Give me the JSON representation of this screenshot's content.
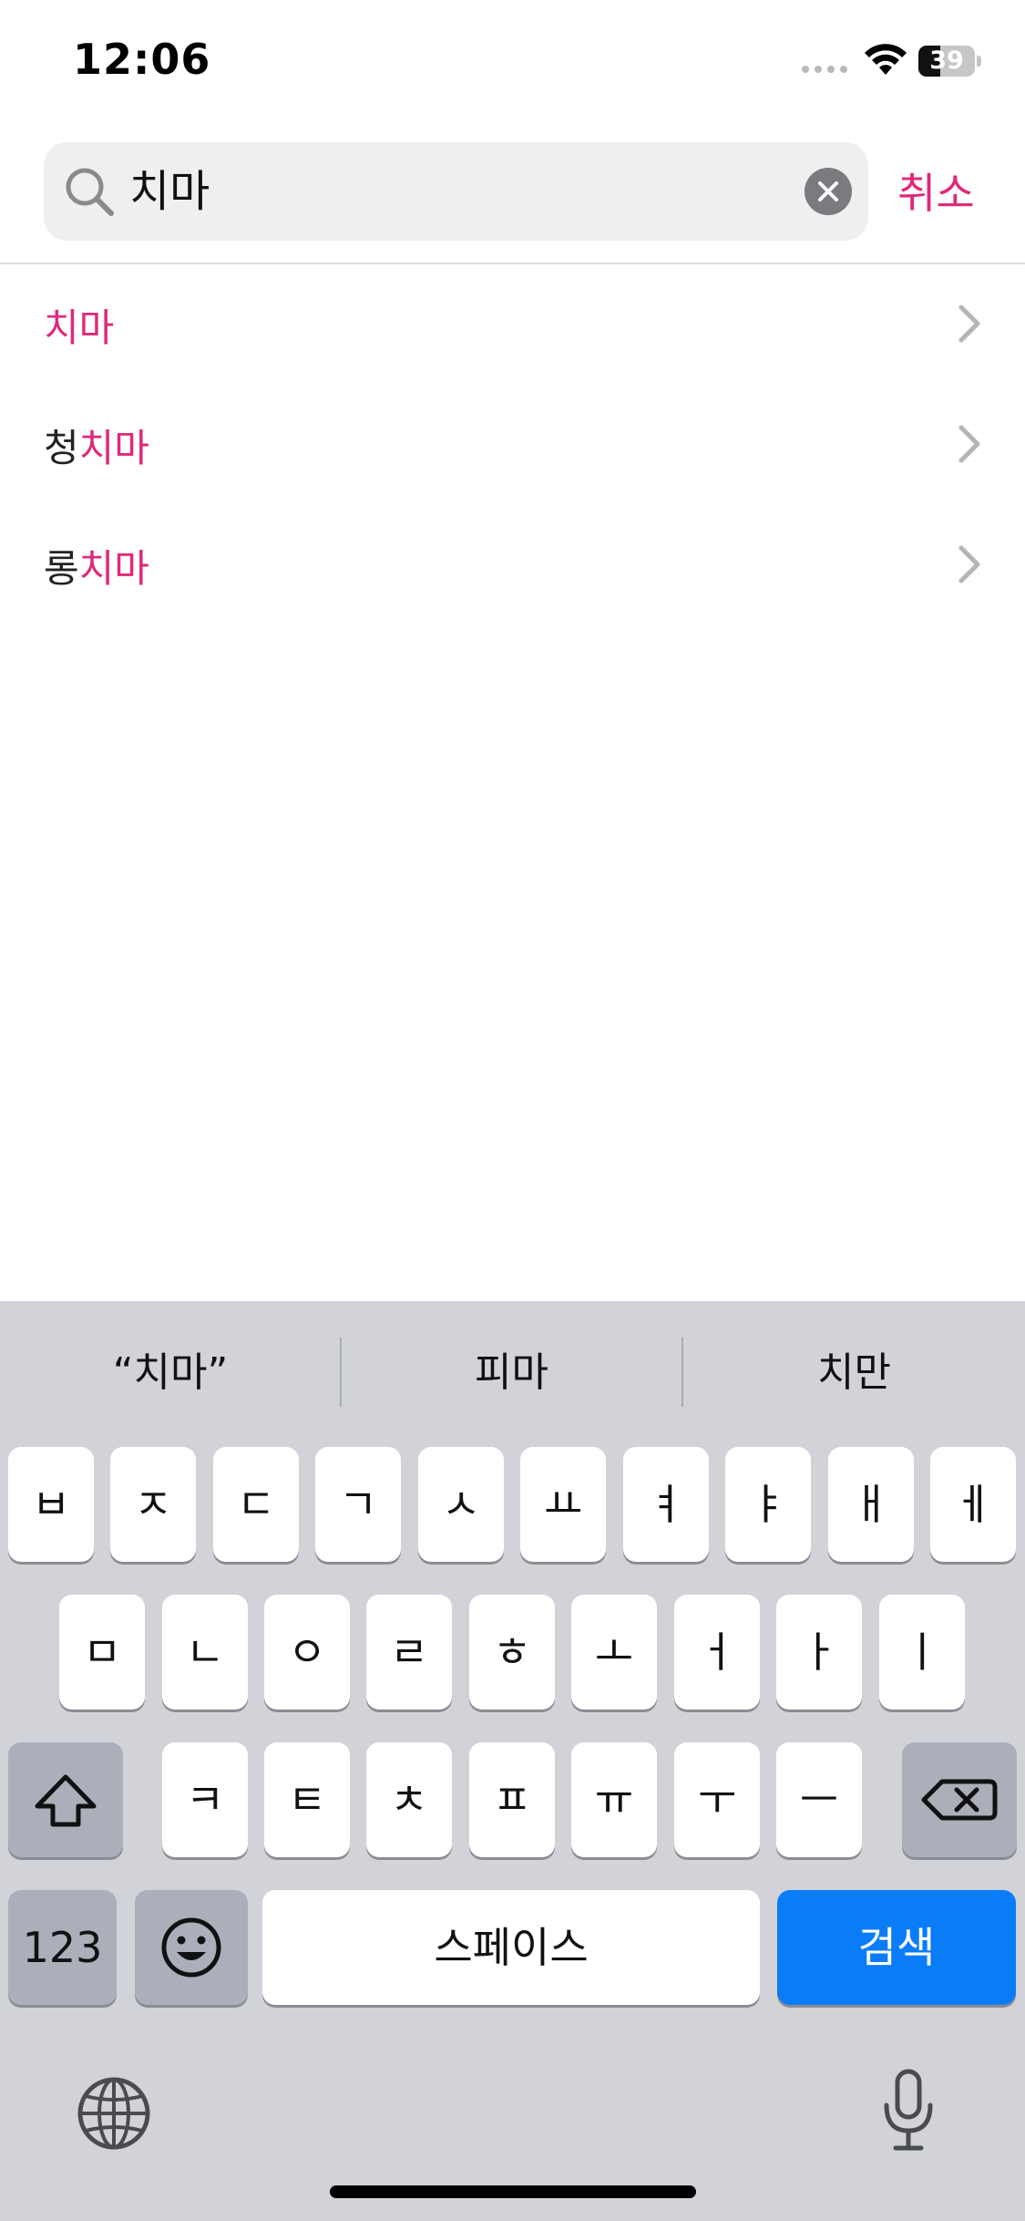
{
  "status_bar": {
    "time": "12:06",
    "battery_level": "39"
  },
  "search": {
    "query": "치마",
    "cancel_label": "취소",
    "accent_color": "#e0287a"
  },
  "suggestions": [
    {
      "prefix": "",
      "match": "치마"
    },
    {
      "prefix": "청",
      "match": "치마"
    },
    {
      "prefix": "롱",
      "match": "치마"
    }
  ],
  "keyboard": {
    "predictions": [
      "“치마”",
      "피마",
      "치만"
    ],
    "row1": [
      "ㅂ",
      "ㅈ",
      "ㄷ",
      "ㄱ",
      "ㅅ",
      "ㅛ",
      "ㅕ",
      "ㅑ",
      "ㅐ",
      "ㅔ"
    ],
    "row2": [
      "ㅁ",
      "ㄴ",
      "ㅇ",
      "ㄹ",
      "ㅎ",
      "ㅗ",
      "ㅓ",
      "ㅏ",
      "ㅣ"
    ],
    "row3": [
      "ㅋ",
      "ㅌ",
      "ㅊ",
      "ㅍ",
      "ㅠ",
      "ㅜ",
      "ㅡ"
    ],
    "numbers_label": "123",
    "space_label": "스페이스",
    "search_label": "검색",
    "search_key_color": "#0a7cf8"
  }
}
